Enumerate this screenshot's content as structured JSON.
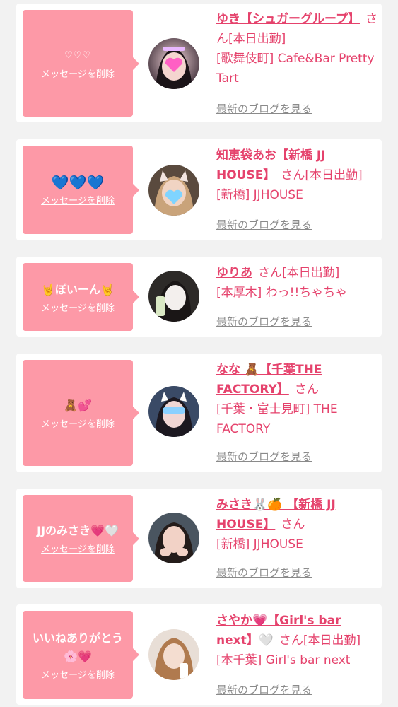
{
  "colors": {
    "accent": "#e5426c",
    "bubble": "#fd99a7",
    "link": "#8a8a8a"
  },
  "delete_label": "メッセージを削除",
  "blog_label": "最新のブログを見る",
  "san_label": "さん",
  "items": [
    {
      "message": "♡♡♡",
      "name": "ゆき【シュガーグループ】",
      "area": "[歌舞伎町] Cafe&Bar Pretty Tart",
      "status": "[本日出勤]",
      "avatar_icon": "pink-heart-sticker"
    },
    {
      "message": "💙💙💙",
      "name": "知恵袋あお【新橋 JJ HOUSE】",
      "area": "[新橋] JJHOUSE",
      "status": "[本日出勤]",
      "avatar_icon": "blue-heart-sticker"
    },
    {
      "message": "🤘ぽいーん🤘",
      "name": "ゆりあ",
      "area": "[本厚木] わっ!!ちゃちゃ",
      "status": "[本日出勤]",
      "avatar_icon": "photo"
    },
    {
      "message": "🧸💕",
      "name": "なな 🧸【千葉THE FACTORY】",
      "area": "[千葉・富士見町] THE FACTORY",
      "status": "",
      "avatar_icon": "photo"
    },
    {
      "message": "JJのみさき💗🤍",
      "name": "みさき🐰🍊 【新橋 JJ HOUSE】",
      "area": "[新橋] JJHOUSE",
      "status": "",
      "avatar_icon": "photo"
    },
    {
      "message": "いいねありがとう🌸💗",
      "name": "さやか💗【Girl's bar next】🤍",
      "area": "[本千葉] Girl's bar next",
      "status": "[本日出勤]",
      "avatar_icon": "photo"
    }
  ]
}
